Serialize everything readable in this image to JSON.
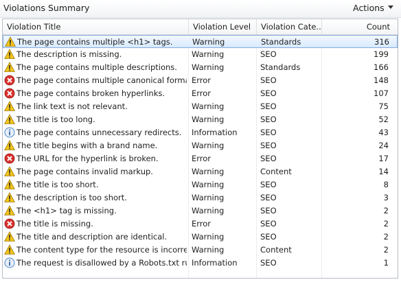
{
  "header": {
    "title": "Violations Summary",
    "actions_label": "Actions"
  },
  "columns": [
    "Violation Title",
    "Violation Level",
    "Violation Cate...",
    "Count"
  ],
  "rows": [
    {
      "title": "The page contains multiple <h1> tags.",
      "level": "Warning",
      "category": "Standards",
      "count": "316",
      "icon": "warning-icon"
    },
    {
      "title": "The description is missing.",
      "level": "Warning",
      "category": "SEO",
      "count": "199",
      "icon": "warning-icon"
    },
    {
      "title": "The page contains multiple descriptions.",
      "level": "Warning",
      "category": "Standards",
      "count": "166",
      "icon": "warning-icon"
    },
    {
      "title": "The page contains multiple canonical formats.",
      "level": "Error",
      "category": "SEO",
      "count": "148",
      "icon": "error-icon"
    },
    {
      "title": "The page contains broken hyperlinks.",
      "level": "Error",
      "category": "SEO",
      "count": "107",
      "icon": "error-icon"
    },
    {
      "title": "The link text is not relevant.",
      "level": "Warning",
      "category": "SEO",
      "count": "75",
      "icon": "warning-icon"
    },
    {
      "title": "The title is too long.",
      "level": "Warning",
      "category": "SEO",
      "count": "52",
      "icon": "warning-icon"
    },
    {
      "title": "The page contains unnecessary redirects.",
      "level": "Information",
      "category": "SEO",
      "count": "43",
      "icon": "info-icon"
    },
    {
      "title": "The title begins with a brand name.",
      "level": "Warning",
      "category": "SEO",
      "count": "24",
      "icon": "warning-icon"
    },
    {
      "title": "The URL for the hyperlink is broken.",
      "level": "Error",
      "category": "SEO",
      "count": "17",
      "icon": "error-icon"
    },
    {
      "title": "The page contains invalid markup.",
      "level": "Warning",
      "category": "Content",
      "count": "14",
      "icon": "warning-icon"
    },
    {
      "title": "The title is too short.",
      "level": "Warning",
      "category": "SEO",
      "count": "8",
      "icon": "warning-icon"
    },
    {
      "title": "The description is too short.",
      "level": "Warning",
      "category": "SEO",
      "count": "3",
      "icon": "warning-icon"
    },
    {
      "title": "The <h1> tag is missing.",
      "level": "Warning",
      "category": "SEO",
      "count": "2",
      "icon": "warning-icon"
    },
    {
      "title": "The title is missing.",
      "level": "Error",
      "category": "SEO",
      "count": "2",
      "icon": "error-icon"
    },
    {
      "title": "The title and description are identical.",
      "level": "Warning",
      "category": "SEO",
      "count": "2",
      "icon": "warning-icon"
    },
    {
      "title": "The content type for the resource is incorrect.",
      "level": "Warning",
      "category": "Content",
      "count": "2",
      "icon": "warning-icon"
    },
    {
      "title": "The request is disallowed by a Robots.txt rule.",
      "level": "Information",
      "category": "SEO",
      "count": "1",
      "icon": "info-icon"
    }
  ],
  "selected_row": 0,
  "colors": {
    "selection_border": "#84acdd",
    "warning": "#f2c300",
    "error": "#d9302c",
    "info": "#4a86c7"
  }
}
